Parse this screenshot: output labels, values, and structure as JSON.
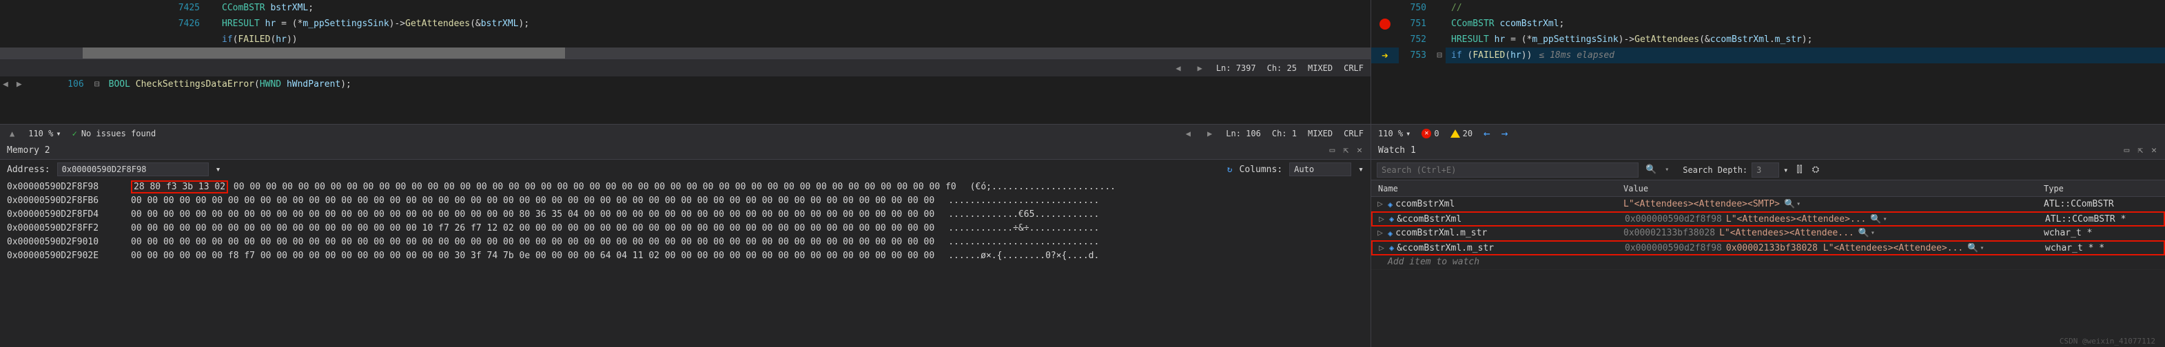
{
  "left_editor": {
    "lines": [
      {
        "gutter": "7425",
        "txt": "CComBSTR bstrXML;"
      },
      {
        "gutter": "7426",
        "txt": "HRESULT hr = (*m_ppSettingsSink)->GetAttendees(&bstrXML);"
      },
      {
        "gutter": "",
        "txt": "if(FAILED(hr))"
      }
    ],
    "status1": {
      "line": "Ln: 7397",
      "col": "Ch: 25",
      "enc": "MIXED",
      "eol": "CRLF"
    },
    "bottom_line": {
      "gutter": "106",
      "txt": "BOOL CheckSettingsDataError(HWND hWndParent);"
    },
    "status2": {
      "zoom": "110 %",
      "issues": "No issues found",
      "line": "Ln: 106",
      "col": "Ch: 1",
      "enc": "MIXED",
      "eol": "CRLF"
    }
  },
  "right_editor": {
    "lines": [
      {
        "gutter": "750",
        "bp": false,
        "txt": "//"
      },
      {
        "gutter": "751",
        "bp": "dot",
        "txt": "CComBSTR ccomBstrXml;"
      },
      {
        "gutter": "752",
        "bp": false,
        "txt": "HRESULT hr = (*m_ppSettingsSink)->GetAttendees(&ccomBstrXml.m_str);"
      },
      {
        "gutter": "753",
        "bp": "arrow",
        "txt": "if (FAILED(hr))",
        "tip": "≤ 18ms elapsed"
      }
    ],
    "status": {
      "zoom": "110 %",
      "errors": "0",
      "warnings": "20"
    }
  },
  "memory": {
    "title": "Memory 2",
    "addr_label": "Address:",
    "addr_value": "0x00000590D2F8F98",
    "columns_label": "Columns:",
    "columns_value": "Auto",
    "rows": [
      {
        "addr": "0x00000590D2F8F98",
        "hex_hl": "28 80 f3 3b 13 02",
        "hex_rest": " 00 00 00 00 00 00 00 00 00 00 00 00 00 00 00 00 00 00 00 00 00 00 00 00 00 00 00 00 00 00 00 00 00 00 00 00 00 00 00 00 00 00 00 00 f0",
        "ascii": "(€ó;......................."
      },
      {
        "addr": "0x00000590D2F8FB6",
        "hex_rest": "00 00 00 00 00 00 00 00 00 00 00 00 00 00 00 00 00 00 00 00 00 00 00 00 00 00 00 00 00 00 00 00 00 00 00 00 00 00 00 00 00 00 00 00 00 00 00 00 00 00",
        "ascii": "............................"
      },
      {
        "addr": "0x00000590D2F8FD4",
        "hex_rest": "00 00 00 00 00 00 00 00 00 00 00 00 00 00 00 00 00 00 00 00 00 00 00 00 80 36 35 04 00 00 00 00 00 00 00 00 00 00 00 00 00 00 00 00 00 00 00 00 00 00",
        "ascii": ".............€65............"
      },
      {
        "addr": "0x00000590D2F8FF2",
        "hex_rest": "00 00 00 00 00 00 00 00 00 00 00 00 00 00 00 00 00 00 10 f7 26 f7 12 02 00 00 00 00 00 00 00 00 00 00 00 00 00 00 00 00 00 00 00 00 00 00 00 00 00 00",
        "ascii": "............÷&÷............."
      },
      {
        "addr": "0x00000590D2F9010",
        "hex_rest": "00 00 00 00 00 00 00 00 00 00 00 00 00 00 00 00 00 00 00 00 00 00 00 00 00 00 00 00 00 00 00 00 00 00 00 00 00 00 00 00 00 00 00 00 00 00 00 00 00 00",
        "ascii": "............................"
      },
      {
        "addr": "0x00000590D2F902E",
        "hex_rest": "00 00 00 00 00 00 f8 f7 00 00 00 00 00 00 00 00 00 00 00 00 30 3f 74 7b 0e 00 00 00 00 64 04 11 02 00 00 00 00 00 00 00 00 00 00 00 00 00 00 00 00 00",
        "ascii": "......ø×.{........0?×{....d."
      }
    ]
  },
  "watch": {
    "title": "Watch 1",
    "search_placeholder": "Search (Ctrl+E)",
    "depth_label": "Search Depth:",
    "depth_value": "3",
    "cols": {
      "name": "Name",
      "value": "Value",
      "type": "Type"
    },
    "rows": [
      {
        "name": "ccomBstrXml",
        "value": "L\"<Attendees><Attendee><SMTP>",
        "type": "ATL::CComBSTR",
        "sel": false
      },
      {
        "name": "&ccomBstrXml",
        "ptr": "0x000000590d2f8f98",
        "value": "L\"<Attendees><Attendee>...",
        "type": "ATL::CComBSTR *",
        "sel": true
      },
      {
        "name": "ccomBstrXml.m_str",
        "ptr": "0x00002133bf38028",
        "value": "L\"<Attendees><Attendee...",
        "type": "wchar_t *",
        "sel": false
      },
      {
        "name": "&ccomBstrXml.m_str",
        "ptr": "0x000000590d2f8f98",
        "value": "0x00002133bf38028 L\"<Attendees><Attendee>...",
        "type": "wchar_t * *",
        "sel": true
      }
    ],
    "add_item": "Add item to watch"
  },
  "watermark": "CSDN @weixin_41077112",
  "icons": {
    "check": "✓",
    "pin": "⇱",
    "close": "✕",
    "dropdown": "▾",
    "refresh": "↻",
    "play": "▶",
    "left": "←",
    "right": "→",
    "search": "🔍",
    "filter": "⚗"
  }
}
